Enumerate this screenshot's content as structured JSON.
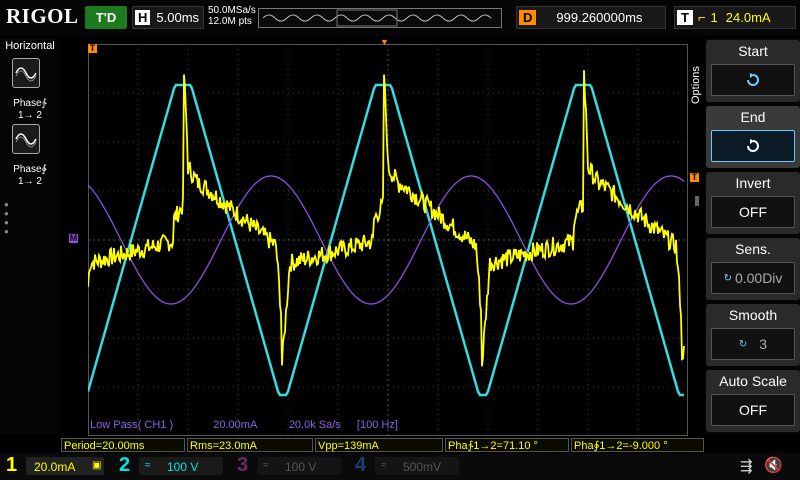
{
  "brand": "RIGOL",
  "top": {
    "trigger_state": "T'D",
    "horizontal_key": "H",
    "timebase": "5.00ms",
    "sample_rate": "50.0MSa/s",
    "memory_depth": "12.0M pts",
    "delay_key": "D",
    "delay_value": "999.260000ms",
    "trigger_key": "T",
    "trigger_edge_icon": "falling-edge-icon",
    "trigger_source_num": "1",
    "trigger_level": "24.0mA"
  },
  "left_panel": {
    "title": "Horizontal",
    "items": [
      {
        "label": "Phase∱",
        "sub": "1→ 2",
        "icon": "phase-rising-icon"
      },
      {
        "label": "Phase∲",
        "sub": "1→ 2",
        "icon": "phase-falling-icon"
      }
    ]
  },
  "right_menu": {
    "options_label": "Options",
    "items": [
      {
        "title": "Start",
        "value": "",
        "icon": "rotate-icon"
      },
      {
        "title": "End",
        "value": "",
        "icon": "rotate-icon"
      },
      {
        "title": "Invert",
        "value": "OFF"
      },
      {
        "title": "Sens.",
        "value": "0.00Div"
      },
      {
        "title": "Smooth",
        "value": "3"
      },
      {
        "title": "Auto Scale",
        "value": "OFF"
      }
    ]
  },
  "filter_info": {
    "name": "Low Pass( CH1 )",
    "scale": "20.00mA",
    "rate": "20.0k Sa/s",
    "cutoff": "[100 Hz]"
  },
  "measurements": [
    "Period=20.00ms",
    "Rms=23.0mA",
    "Vpp=139mA",
    "Pha∱1→2=71.10 °",
    "Pha∲1→2=-9.000 °"
  ],
  "channels": [
    {
      "num": "1",
      "scale": "20.0mA",
      "color": "#ffff00"
    },
    {
      "num": "2",
      "scale": "100 V",
      "color": "#00e5e5"
    },
    {
      "num": "3",
      "scale": "100 V",
      "color": "#d35fd3"
    },
    {
      "num": "4",
      "scale": "500mV",
      "color": "#2d7cf0"
    }
  ],
  "colors": {
    "ch1": "#ffff00",
    "ch2": "#33dde0",
    "math": "#8f4fe0",
    "trigger": "#ff8c00",
    "grid": "#3a3a3a"
  }
}
